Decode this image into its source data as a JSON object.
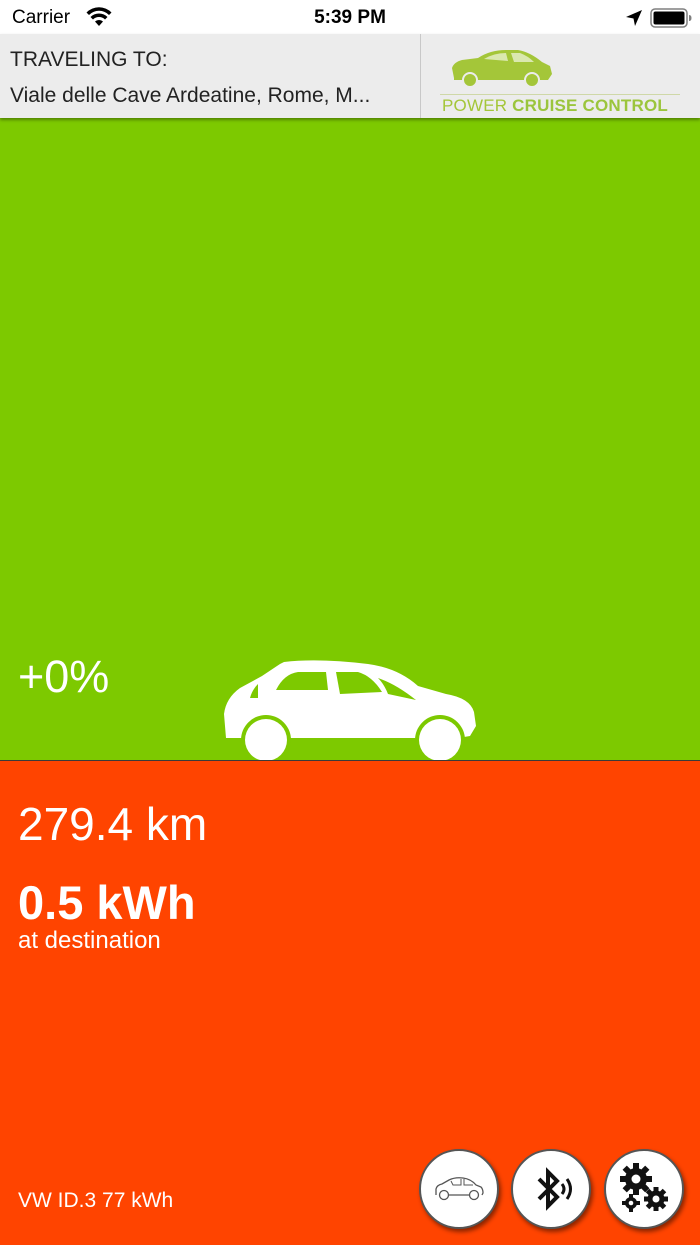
{
  "status_bar": {
    "carrier": "Carrier",
    "time": "5:39 PM"
  },
  "header": {
    "label": "TRAVELING TO:",
    "destination": "Viale delle Cave Ardeatine, Rome, M...",
    "logo_text_light": "POWER ",
    "logo_text_bold": "CRUISE CONTROL"
  },
  "gauge": {
    "percent": "+0%"
  },
  "stats": {
    "distance": "279.4 km",
    "energy": "0.5 kWh",
    "energy_caption": "at destination",
    "vehicle": "VW ID.3 77 kWh"
  },
  "colors": {
    "green": "#7dc900",
    "red": "#ff4400",
    "logo_green": "#a4c639"
  },
  "icons": [
    "wifi-icon",
    "location-arrow-icon",
    "battery-icon",
    "car-icon",
    "bluetooth-icon",
    "settings-icon"
  ]
}
